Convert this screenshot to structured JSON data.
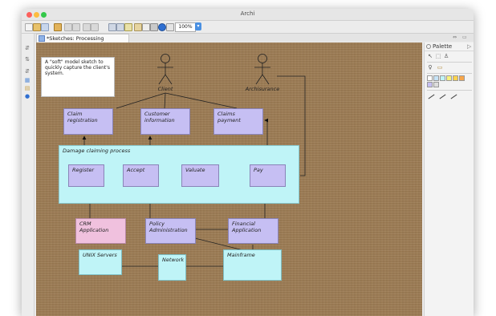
{
  "window": {
    "title": "Archi"
  },
  "toolbar": {
    "zoom_value": "100%"
  },
  "editor": {
    "tab_label": "*Sketches: Processing Sketch",
    "tab_close": "⊠",
    "view_controls": [
      "⇔",
      "▭"
    ]
  },
  "sketch": {
    "note_text": "A \"soft\" model sketch to quickly capture the client's system.",
    "actors": {
      "client": "Client",
      "archisurance": "Archisurance"
    },
    "services": {
      "claim_registration": "Claim registration",
      "customer_information": "Customer information",
      "claims_payment": "Claims payment"
    },
    "process_group": "Damage claiming process",
    "steps": {
      "register": "Register",
      "accept": "Accept",
      "valuate": "Valuate",
      "pay": "Pay"
    },
    "applications": {
      "crm": "CRM Application",
      "policy": "Policy Administration",
      "financial": "Financial Application"
    },
    "infrastructure": {
      "unix": "UNIX Servers",
      "network": "Network",
      "mainframe": "Mainframe"
    }
  },
  "palette": {
    "title": "Palette",
    "swatch_colors": [
      "#ffffff",
      "#c6e3f7",
      "#bff4f7",
      "#f9f27a",
      "#ffd24d",
      "#f7a64a",
      "#c6bff3",
      "#dddddd"
    ]
  },
  "colors": {
    "canvas": "#9b7a52",
    "business_object": "#c6bff3",
    "infrastructure": "#bff4f7",
    "crm": "#f0c1de",
    "zoom_button": "#4a90e2"
  }
}
